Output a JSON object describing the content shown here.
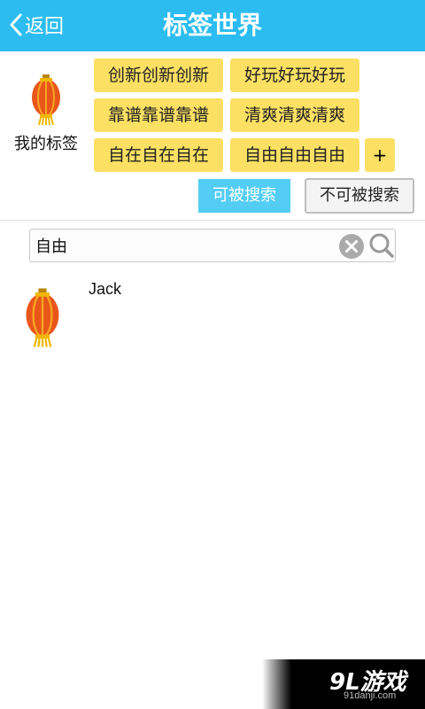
{
  "header": {
    "back_label": "返回",
    "title": "标签世界"
  },
  "my_tags": {
    "label": "我的标签",
    "tags": [
      "创新创新创新",
      "好玩好玩好玩",
      "靠谱靠谱靠谱",
      "清爽清爽清爽",
      "自在自在自在",
      "自由自由自由"
    ],
    "add_label": "+"
  },
  "visibility": {
    "searchable_label": "可被搜索",
    "unsearchable_label": "不可被搜索",
    "selected": "可被搜索"
  },
  "search": {
    "value": "自由",
    "placeholder": ""
  },
  "results": [
    {
      "name": "Jack",
      "icon": "lantern-avatar-icon"
    }
  ],
  "watermark": {
    "logo": "9L游戏",
    "url": "91danji.com"
  },
  "colors": {
    "header": "#2cbcf0",
    "tag": "#fbe063",
    "selected_button": "#54cdf5"
  }
}
